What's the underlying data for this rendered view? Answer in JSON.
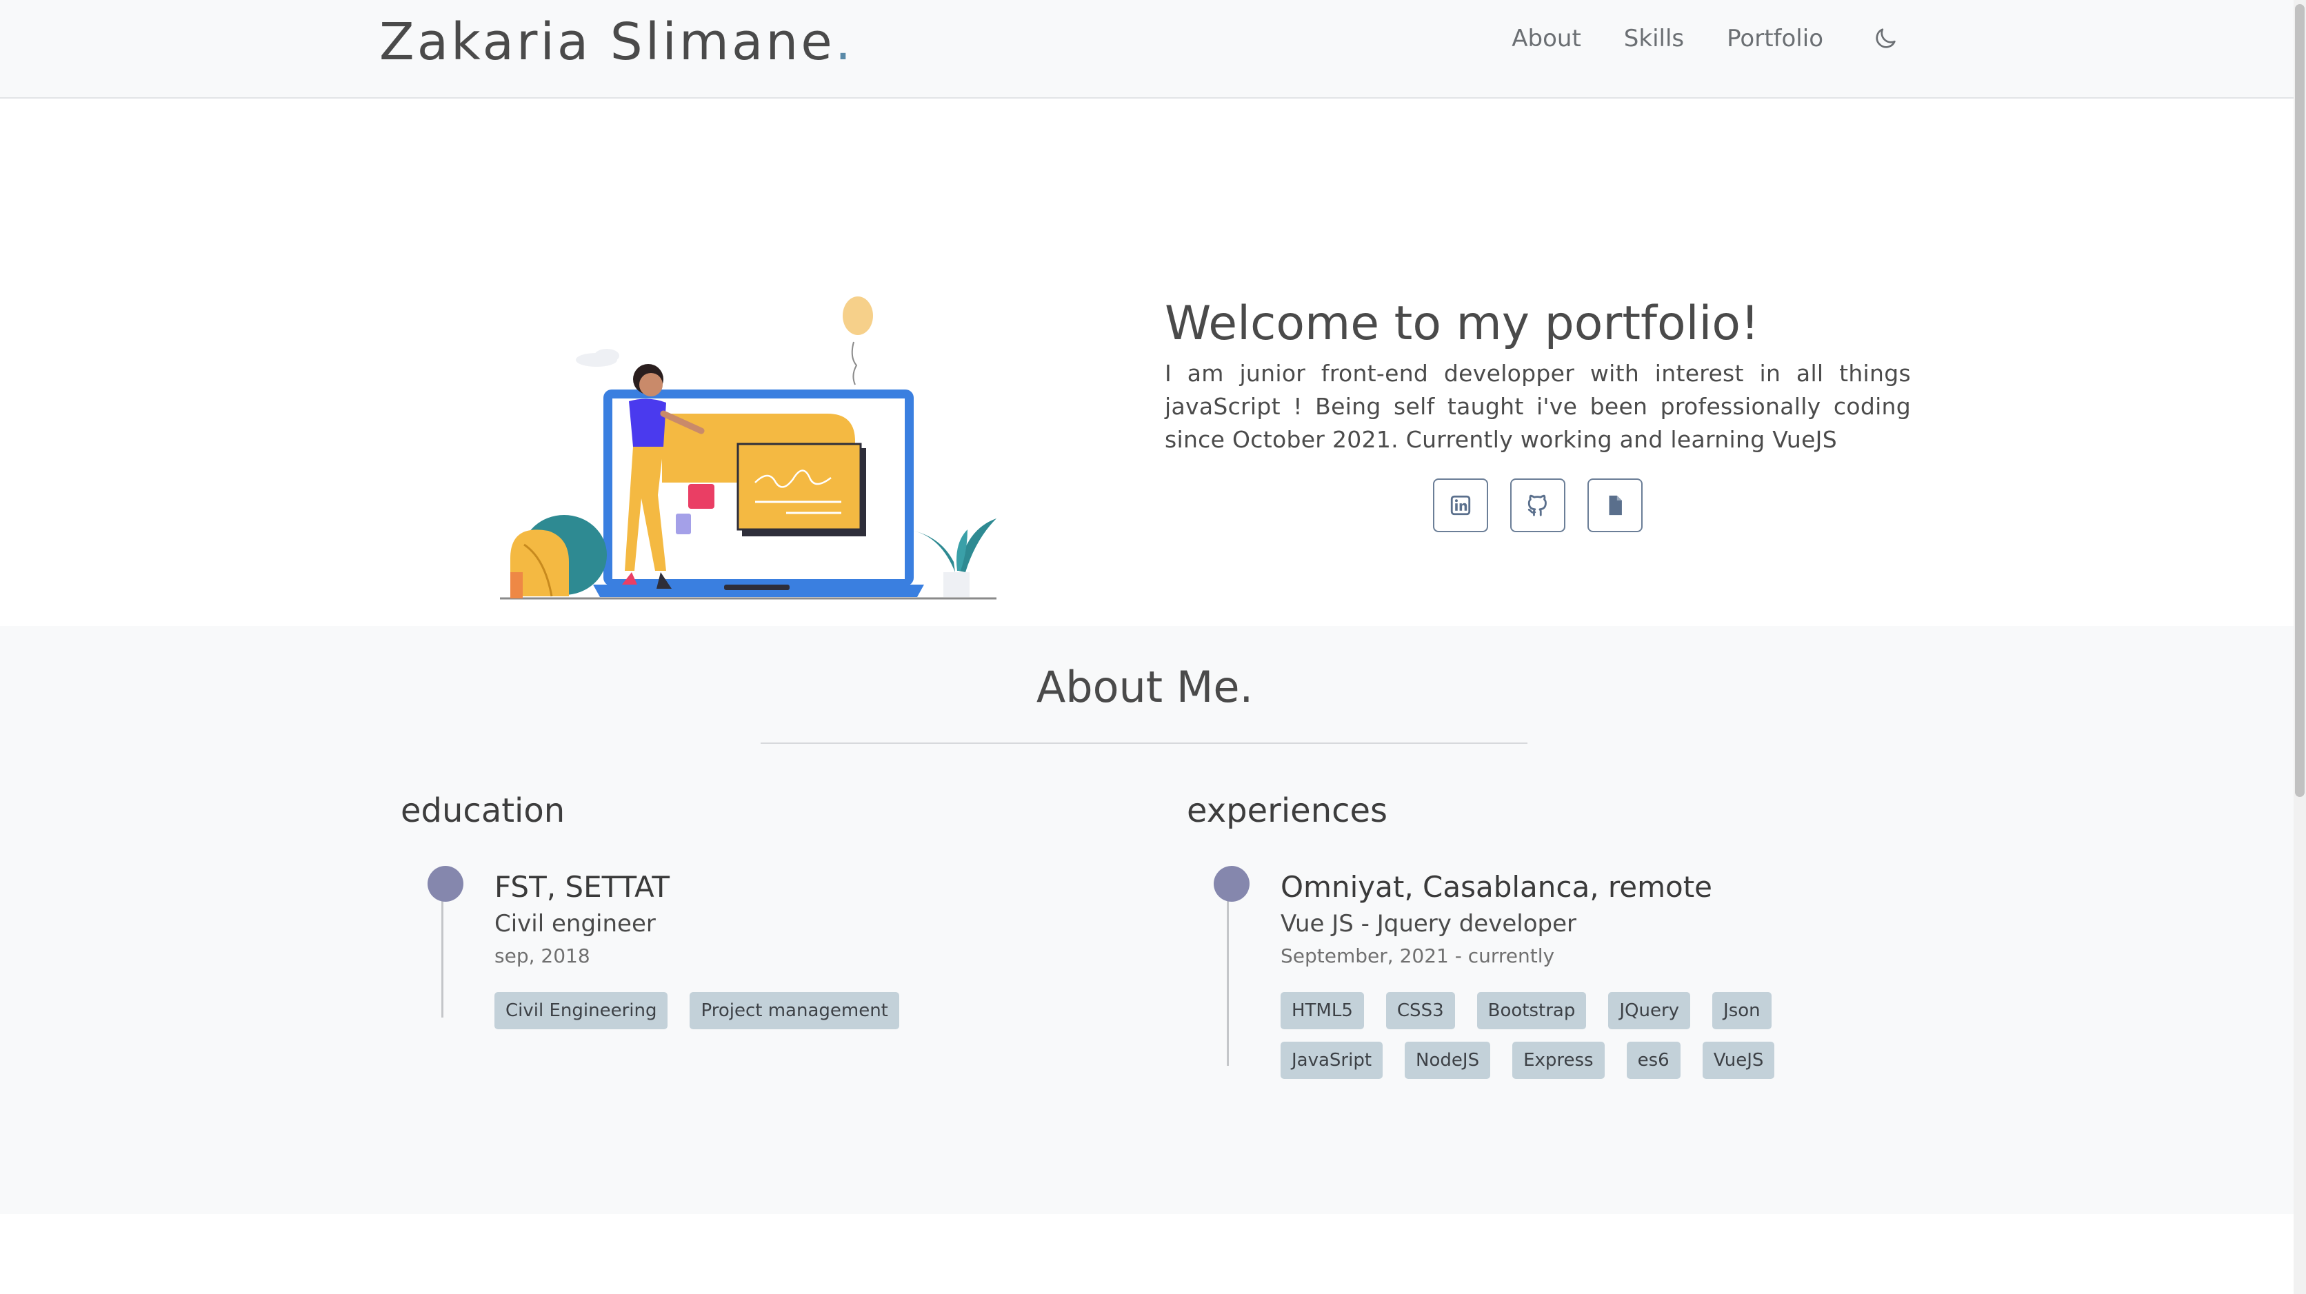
{
  "navbar": {
    "brand": "Zakaria Slimane",
    "brand_dot": ".",
    "links": [
      "About",
      "Skills",
      "Portfolio"
    ],
    "theme_toggle_icon": "moon-icon"
  },
  "hero": {
    "title": "Welcome to my portfolio!",
    "text": "I am junior front-end developper with interest in all things javaScript ! Being self taught i've been professionally coding since October 2021. Currently working and learning VueJS",
    "icons": [
      "linkedin-icon",
      "github-icon",
      "document-icon"
    ]
  },
  "about": {
    "title": "About Me.",
    "education": {
      "heading": "education",
      "title": "FST, SETTAT",
      "subtitle": "Civil engineer",
      "date": "sep, 2018",
      "tags": [
        "Civil Engineering",
        "Project management"
      ]
    },
    "experiences": {
      "heading": "experiences",
      "title": "Omniyat, Casablanca, remote",
      "subtitle": "Vue JS - Jquery developer",
      "date": "September, 2021 - currently",
      "tags": [
        "HTML5",
        "CSS3",
        "Bootstrap",
        "JQuery",
        "Json",
        "JavaSript",
        "NodeJS",
        "Express",
        "es6",
        "VueJS"
      ]
    }
  },
  "colors": {
    "accent_dot": "#5a8aa8",
    "timeline_dot": "#8587ad",
    "tag_bg": "#c3d1d9",
    "section_bg": "#f8f9fa"
  }
}
